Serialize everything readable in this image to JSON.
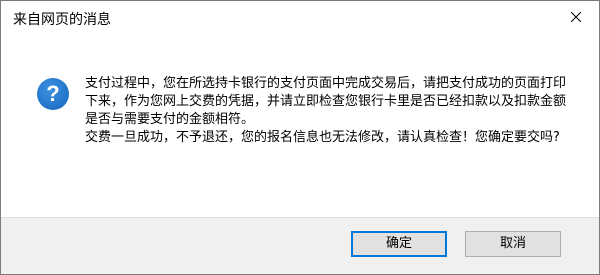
{
  "window": {
    "title": "来自网页的消息"
  },
  "icons": {
    "close": "close-icon",
    "message": "question-icon",
    "message_color": "#1e6fc5"
  },
  "message": {
    "paragraph1": "支付过程中，您在所选持卡银行的支付页面中完成交易后，请把支付成功的页面打印下来，作为您网上交费的凭据，并请立即检查您银行卡里是否已经扣款以及扣款金额是否与需要支付的金额相符。",
    "paragraph2": "交费一旦成功，不予退还，您的报名信息也无法修改，请认真检查！您确定要交吗?"
  },
  "buttons": {
    "ok_label": "确定",
    "cancel_label": "取消",
    "default_border_color": "#0078d7"
  }
}
